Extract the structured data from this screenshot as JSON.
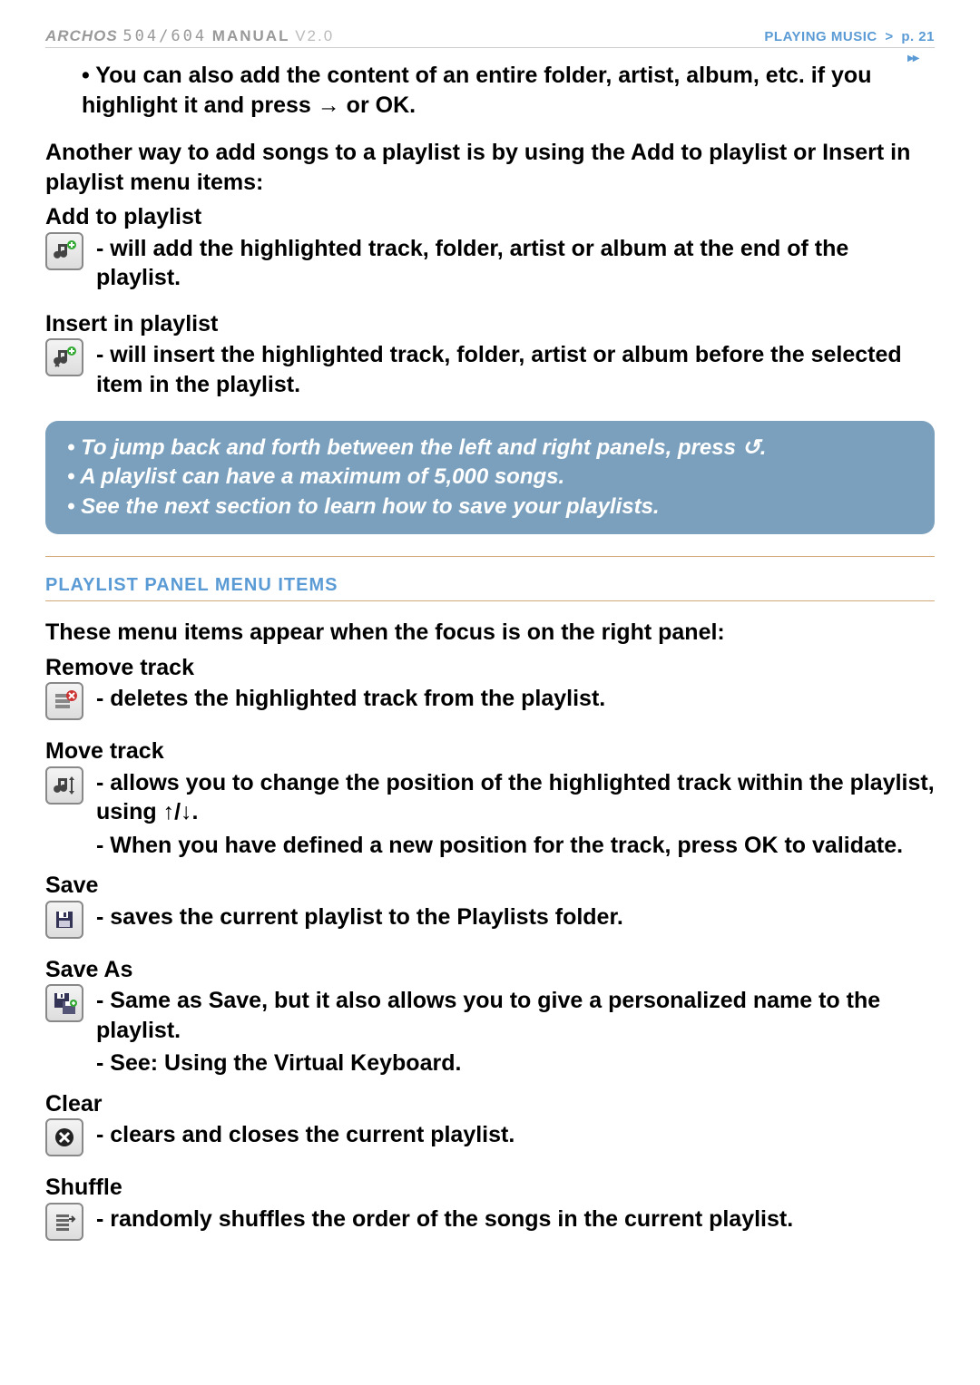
{
  "header": {
    "brand": "ARCHOS",
    "model": "504/604",
    "manual_label": "MANUAL",
    "version": "V2.0",
    "section": "PLAYING MUSIC",
    "sep": ">",
    "page": "p. 21"
  },
  "top_bullet": "You can also add the content of an entire folder, artist, album, etc. if you highlight it and press → or OK.",
  "another_way": "Another way to add songs to a playlist is by using the Add to playlist or Insert in playlist menu items:",
  "add_title": "Add to playlist",
  "add_desc": "will add the highlighted track, folder, artist or album at the end of the playlist.",
  "insert_title": "Insert in playlist",
  "insert_desc": "will insert the highlighted track, folder, artist or album before the selected item in the playlist.",
  "callout": {
    "l1": "To jump back and forth between the left and right panels, press ↺.",
    "l2": "A playlist can have a maximum of 5,000 songs.",
    "l3": "See the next section to learn how to save your playlists."
  },
  "section2_title": "PLAYLIST PANEL MENU ITEMS",
  "section2_intro": "These menu items appear when the focus is on the right panel:",
  "remove_title": "Remove track",
  "remove_desc": "deletes the highlighted track from the playlist.",
  "move_title": "Move track",
  "move_desc1": "allows you to change the position of the highlighted track within the playlist, using ↑/↓.",
  "move_desc2": "When you have defined a new position for the track, press OK to validate.",
  "save_title": "Save",
  "save_desc": "saves the current playlist to the Playlists folder.",
  "saveas_title": "Save As",
  "saveas_desc1": "Same as Save, but it also allows you to give a personalized name to the playlist.",
  "saveas_desc2": "See: Using the Virtual Keyboard.",
  "clear_title": "Clear",
  "clear_desc": "clears and closes the current playlist.",
  "shuffle_title": "Shuffle",
  "shuffle_desc": "randomly shuffles the order of the songs in the current playlist."
}
